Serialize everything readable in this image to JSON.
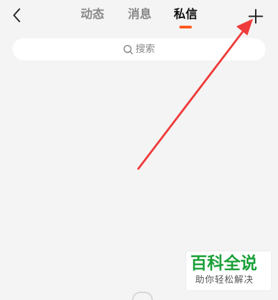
{
  "header": {
    "tabs": [
      {
        "label": "动态",
        "active": false
      },
      {
        "label": "消息",
        "active": false
      },
      {
        "label": "私信",
        "active": true
      }
    ],
    "back_icon": "chevron-left-icon",
    "add_icon": "plus-icon"
  },
  "search": {
    "placeholder": "搜索",
    "icon": "search-icon"
  },
  "watermark": {
    "title": "百科全说",
    "subtitle": "助你轻松解决"
  },
  "colors": {
    "background": "#f4f4f4",
    "accent": "#ff5a1f",
    "arrow": "#ef3b3b",
    "watermark_green": "#1aa038"
  }
}
